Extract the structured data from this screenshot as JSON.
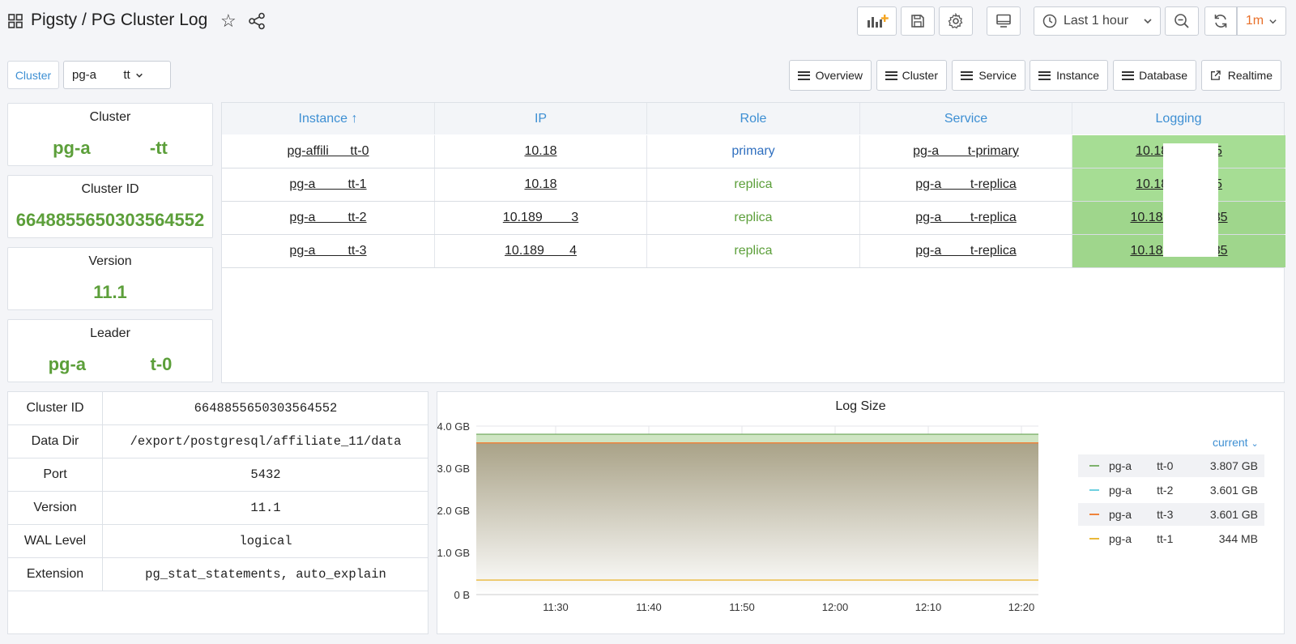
{
  "header": {
    "title": "Pigsty / PG Cluster Log",
    "time_range": "Last 1 hour",
    "refresh_interval": "1m"
  },
  "variables": {
    "cluster_label": "Cluster",
    "cluster_value": "pg-a        tt"
  },
  "nav_links": [
    "Overview",
    "Cluster",
    "Service",
    "Instance",
    "Database",
    "Realtime"
  ],
  "stats": [
    {
      "title": "Cluster",
      "value": "pg-a            -tt"
    },
    {
      "title": "Cluster ID",
      "value": "6648855650303564552"
    },
    {
      "title": "Version",
      "value": "11.1"
    },
    {
      "title": "Leader",
      "value": "pg-a             t-0"
    }
  ],
  "instance_table": {
    "columns": [
      "Instance ↑",
      "IP",
      "Role",
      "Service",
      "Logging"
    ],
    "rows": [
      {
        "instance": "pg-affili      tt-0",
        "ip": "10.18",
        "role": "primary",
        "service": "pg-a        t-primary",
        "logging": "10.18           85"
      },
      {
        "instance": "pg-a         tt-1",
        "ip": "10.18",
        "role": "replica",
        "service": "pg-a        t-replica",
        "logging": "10.18           85"
      },
      {
        "instance": "pg-a         tt-2",
        "ip": "10.189        3",
        "role": "replica",
        "service": "pg-a        t-replica",
        "logging": "10.189          185"
      },
      {
        "instance": "pg-a         tt-3",
        "ip": "10.189       4",
        "role": "replica",
        "service": "pg-a        t-replica",
        "logging": "10.189          185"
      }
    ]
  },
  "config_table": [
    {
      "key": "Cluster ID",
      "value": "6648855650303564552"
    },
    {
      "key": "Data Dir",
      "value": "/export/postgresql/affiliate_11/data"
    },
    {
      "key": "Port",
      "value": "5432"
    },
    {
      "key": "Version",
      "value": "11.1"
    },
    {
      "key": "WAL Level",
      "value": "logical"
    },
    {
      "key": "Extension",
      "value": "pg_stat_statements, auto_explain"
    }
  ],
  "chart_data": {
    "type": "area",
    "title": "Log Size",
    "xlabel": "",
    "ylabel": "",
    "x_ticks": [
      "11:30",
      "11:40",
      "11:50",
      "12:00",
      "12:10",
      "12:20"
    ],
    "y_ticks": [
      "0 B",
      "1.0 GB",
      "2.0 GB",
      "3.0 GB",
      "4.0 GB"
    ],
    "ylim": [
      0,
      4.0
    ],
    "y_unit": "GB",
    "legend_header": "current",
    "legend_placement": "right",
    "series": [
      {
        "name": "pg-a        tt-0",
        "current": "3.807 GB",
        "value_gb": 3.807,
        "color": "#7eb26d"
      },
      {
        "name": "pg-a        tt-2",
        "current": "3.601 GB",
        "value_gb": 3.601,
        "color": "#6ed0e0"
      },
      {
        "name": "pg-a        tt-3",
        "current": "3.601 GB",
        "value_gb": 3.601,
        "color": "#ef843c"
      },
      {
        "name": "pg-a        tt-1",
        "current": "344 MB",
        "value_gb": 0.344,
        "color": "#eab839"
      }
    ]
  },
  "colors": {
    "accent_blue": "#3d8fd3",
    "stat_green": "#5c9f3a",
    "logging_bg": "#a6dd94",
    "refresh_orange": "#e8702a"
  }
}
